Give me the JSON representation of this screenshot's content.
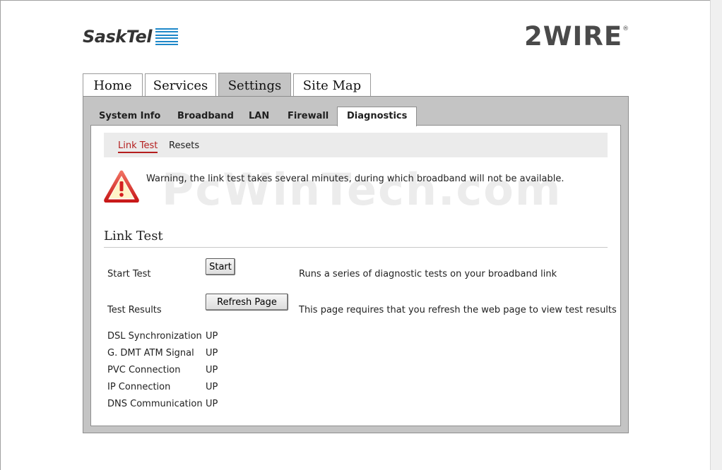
{
  "brand": {
    "left_logo": "SaskTel",
    "right_logo": "2WIRE",
    "right_logo_mark": "®"
  },
  "main_tabs": [
    {
      "label": "Home"
    },
    {
      "label": "Services"
    },
    {
      "label": "Settings",
      "active": true
    },
    {
      "label": "Site Map"
    }
  ],
  "sub_tabs": [
    {
      "label": "System Info"
    },
    {
      "label": "Broadband"
    },
    {
      "label": "LAN"
    },
    {
      "label": "Firewall"
    },
    {
      "label": "Diagnostics",
      "active": true
    }
  ],
  "subnav": [
    {
      "label": "Link Test",
      "active": true
    },
    {
      "label": "Resets"
    }
  ],
  "warning": {
    "icon": "warning-triangle-icon",
    "text": "Warning, the link test takes several minutes, during which broadband will not be available."
  },
  "section": {
    "title": "Link Test"
  },
  "start_test": {
    "label": "Start Test",
    "button": "Start",
    "description": "Runs a series of diagnostic tests on your broadband link"
  },
  "test_results": {
    "label": "Test Results",
    "button": "Refresh Page",
    "description": "This page requires that you refresh the web page to view test results"
  },
  "results": [
    {
      "name": "DSL Synchronization",
      "status": "UP"
    },
    {
      "name": "G. DMT ATM Signal",
      "status": "UP"
    },
    {
      "name": "PVC Connection",
      "status": "UP"
    },
    {
      "name": "IP Connection",
      "status": "UP"
    },
    {
      "name": "DNS Communication",
      "status": "UP"
    }
  ],
  "watermark": "PcWinTech.com",
  "colors": {
    "panel": "#c4c4c4",
    "active_link": "#b41e1e",
    "sasktel_blue": "#1e88c9",
    "warning_red": "#d42020"
  }
}
